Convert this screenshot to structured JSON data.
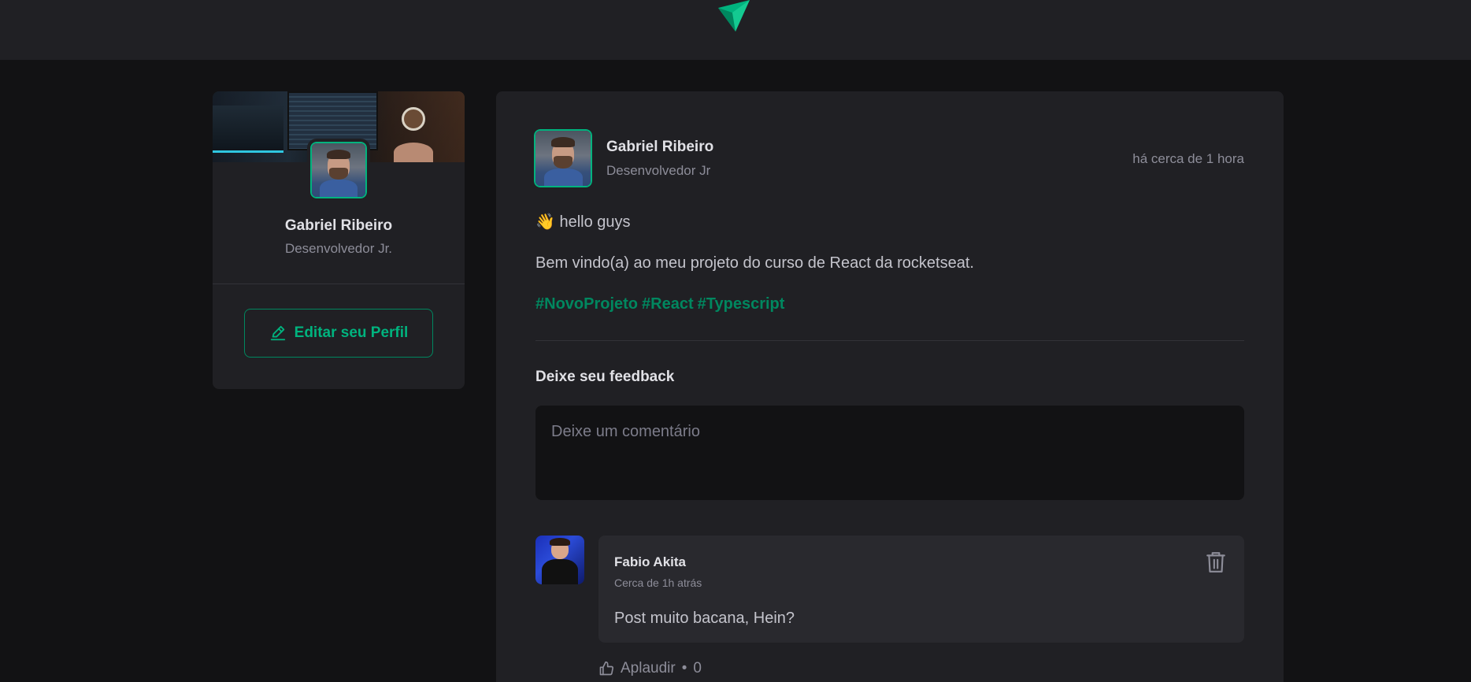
{
  "sidebar": {
    "profile_name": "Gabriel Ribeiro",
    "profile_role": "Desenvolvedor Jr.",
    "edit_button_label": "Editar seu Perfil"
  },
  "post": {
    "author_name": "Gabriel Ribeiro",
    "author_role": "Desenvolvedor Jr",
    "published_time": "há cerca de 1 hora",
    "greeting": "👋 hello guys",
    "body": "Bem vindo(a) ao meu projeto do curso de React da rocketseat.",
    "hashtags": [
      "#NovoProjeto",
      "#React",
      "#Typescript"
    ],
    "feedback_title": "Deixe seu feedback",
    "comment_placeholder": "Deixe um comentário"
  },
  "comment": {
    "author": "Fabio Akita",
    "time": "Cerca de 1h atrás",
    "text": "Post muito bacana, Hein?",
    "applaud_label": "Aplaudir",
    "applaud_separator": "•",
    "applaud_count": "0"
  },
  "colors": {
    "background": "#121214",
    "surface": "#202024",
    "accent": "#00b37e",
    "accent_dark": "#00875f",
    "comment_bg": "#29292e"
  },
  "icons": {
    "logo": "ignite-logo-icon",
    "edit": "pencil-icon",
    "delete": "trash-icon",
    "applaud": "thumbs-up-icon"
  }
}
